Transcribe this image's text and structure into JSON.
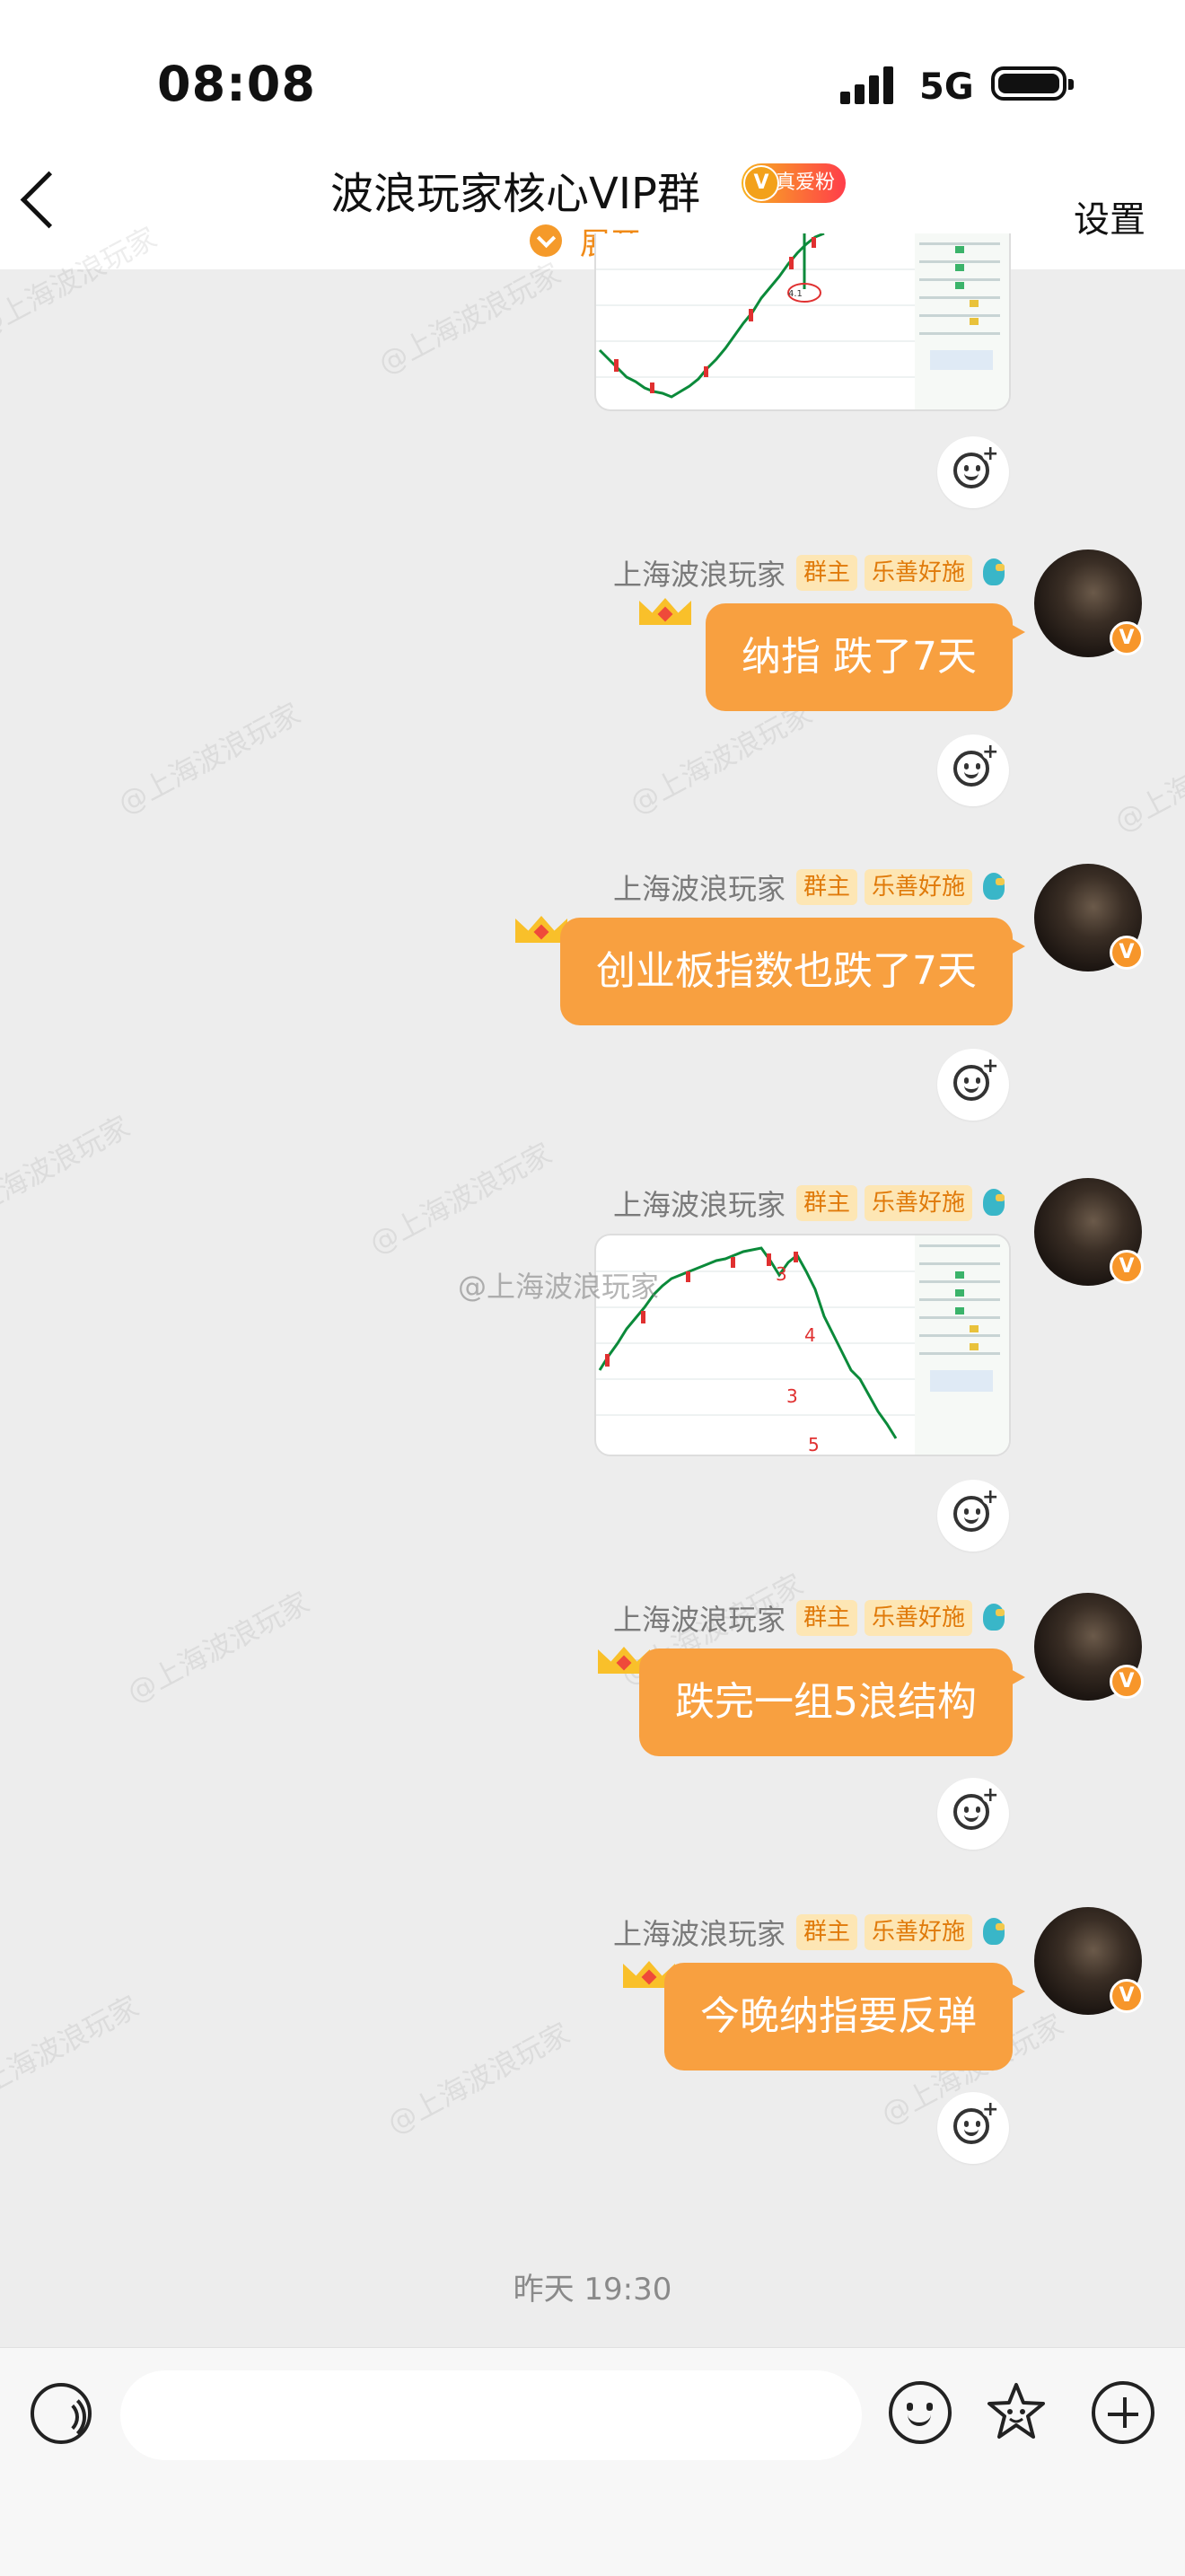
{
  "status_bar": {
    "time": "08:08",
    "network": "5G"
  },
  "header": {
    "title": "波浪玩家核心VIP群",
    "badge": "真爱粉",
    "badge_icon_letter": "V",
    "expand_label": "展开",
    "settings_label": "设置"
  },
  "watermark": "@上海波浪玩家",
  "image_watermark": "@上海波浪玩家",
  "sender": {
    "name": "上海波浪玩家",
    "tags": [
      "群主",
      "乐善好施"
    ],
    "verified_letter": "V"
  },
  "messages": [
    {
      "type": "image",
      "content": "chart-image"
    },
    {
      "type": "text",
      "content": "纳指  跌了7天"
    },
    {
      "type": "text",
      "content": "创业板指数也跌了7天"
    },
    {
      "type": "image",
      "content": "chart-image"
    },
    {
      "type": "text",
      "content": "跌完一组5浪结构"
    },
    {
      "type": "text",
      "content": "今晚纳指要反弹"
    }
  ],
  "chart_annotations": {
    "wave_labels": [
      "3",
      "4",
      "3",
      "5"
    ],
    "small_label": "4.1"
  },
  "timestamp": "昨天 19:30",
  "input": {
    "placeholder": ""
  },
  "icons": [
    "back-chevron-icon",
    "signal-icon",
    "battery-icon",
    "voice-icon",
    "emoji-icon",
    "favorite-icon",
    "plus-icon",
    "add-reaction-icon",
    "crown-icon",
    "bird-badge-icon"
  ],
  "colors": {
    "accent": "#f8a040",
    "tag_bg": "#fde6b4",
    "tag_text": "#e07a0a",
    "background": "#ededed"
  }
}
